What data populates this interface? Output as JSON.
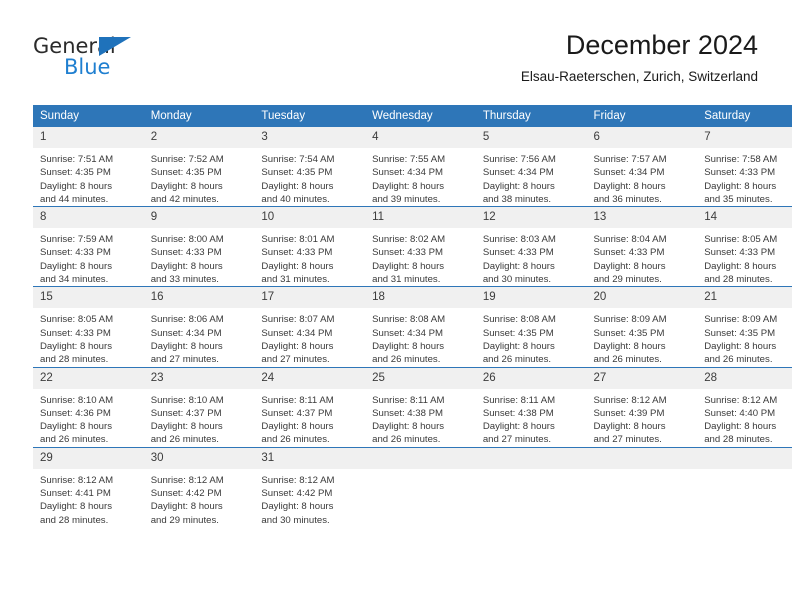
{
  "logo": {
    "word_top": "General",
    "word_bottom": "Blue",
    "triangle_icon": "triangle-icon",
    "color_dark": "#2b2b2b",
    "color_blue": "#1f7fd0"
  },
  "header": {
    "title": "December 2024",
    "subtitle": "Elsau-Raeterschen, Zurich, Switzerland"
  },
  "theme": {
    "header_blue": "#2e76b8",
    "daynum_band": "#f0f0f0",
    "text": "#3a3a3a"
  },
  "calendar": {
    "weekday_headers": [
      "Sunday",
      "Monday",
      "Tuesday",
      "Wednesday",
      "Thursday",
      "Friday",
      "Saturday"
    ],
    "weeks": [
      [
        {
          "day": "1",
          "sunrise": "Sunrise: 7:51 AM",
          "sunset": "Sunset: 4:35 PM",
          "daylight_1": "Daylight: 8 hours",
          "daylight_2": "and 44 minutes."
        },
        {
          "day": "2",
          "sunrise": "Sunrise: 7:52 AM",
          "sunset": "Sunset: 4:35 PM",
          "daylight_1": "Daylight: 8 hours",
          "daylight_2": "and 42 minutes."
        },
        {
          "day": "3",
          "sunrise": "Sunrise: 7:54 AM",
          "sunset": "Sunset: 4:35 PM",
          "daylight_1": "Daylight: 8 hours",
          "daylight_2": "and 40 minutes."
        },
        {
          "day": "4",
          "sunrise": "Sunrise: 7:55 AM",
          "sunset": "Sunset: 4:34 PM",
          "daylight_1": "Daylight: 8 hours",
          "daylight_2": "and 39 minutes."
        },
        {
          "day": "5",
          "sunrise": "Sunrise: 7:56 AM",
          "sunset": "Sunset: 4:34 PM",
          "daylight_1": "Daylight: 8 hours",
          "daylight_2": "and 38 minutes."
        },
        {
          "day": "6",
          "sunrise": "Sunrise: 7:57 AM",
          "sunset": "Sunset: 4:34 PM",
          "daylight_1": "Daylight: 8 hours",
          "daylight_2": "and 36 minutes."
        },
        {
          "day": "7",
          "sunrise": "Sunrise: 7:58 AM",
          "sunset": "Sunset: 4:33 PM",
          "daylight_1": "Daylight: 8 hours",
          "daylight_2": "and 35 minutes."
        }
      ],
      [
        {
          "day": "8",
          "sunrise": "Sunrise: 7:59 AM",
          "sunset": "Sunset: 4:33 PM",
          "daylight_1": "Daylight: 8 hours",
          "daylight_2": "and 34 minutes."
        },
        {
          "day": "9",
          "sunrise": "Sunrise: 8:00 AM",
          "sunset": "Sunset: 4:33 PM",
          "daylight_1": "Daylight: 8 hours",
          "daylight_2": "and 33 minutes."
        },
        {
          "day": "10",
          "sunrise": "Sunrise: 8:01 AM",
          "sunset": "Sunset: 4:33 PM",
          "daylight_1": "Daylight: 8 hours",
          "daylight_2": "and 31 minutes."
        },
        {
          "day": "11",
          "sunrise": "Sunrise: 8:02 AM",
          "sunset": "Sunset: 4:33 PM",
          "daylight_1": "Daylight: 8 hours",
          "daylight_2": "and 31 minutes."
        },
        {
          "day": "12",
          "sunrise": "Sunrise: 8:03 AM",
          "sunset": "Sunset: 4:33 PM",
          "daylight_1": "Daylight: 8 hours",
          "daylight_2": "and 30 minutes."
        },
        {
          "day": "13",
          "sunrise": "Sunrise: 8:04 AM",
          "sunset": "Sunset: 4:33 PM",
          "daylight_1": "Daylight: 8 hours",
          "daylight_2": "and 29 minutes."
        },
        {
          "day": "14",
          "sunrise": "Sunrise: 8:05 AM",
          "sunset": "Sunset: 4:33 PM",
          "daylight_1": "Daylight: 8 hours",
          "daylight_2": "and 28 minutes."
        }
      ],
      [
        {
          "day": "15",
          "sunrise": "Sunrise: 8:05 AM",
          "sunset": "Sunset: 4:33 PM",
          "daylight_1": "Daylight: 8 hours",
          "daylight_2": "and 28 minutes."
        },
        {
          "day": "16",
          "sunrise": "Sunrise: 8:06 AM",
          "sunset": "Sunset: 4:34 PM",
          "daylight_1": "Daylight: 8 hours",
          "daylight_2": "and 27 minutes."
        },
        {
          "day": "17",
          "sunrise": "Sunrise: 8:07 AM",
          "sunset": "Sunset: 4:34 PM",
          "daylight_1": "Daylight: 8 hours",
          "daylight_2": "and 27 minutes."
        },
        {
          "day": "18",
          "sunrise": "Sunrise: 8:08 AM",
          "sunset": "Sunset: 4:34 PM",
          "daylight_1": "Daylight: 8 hours",
          "daylight_2": "and 26 minutes."
        },
        {
          "day": "19",
          "sunrise": "Sunrise: 8:08 AM",
          "sunset": "Sunset: 4:35 PM",
          "daylight_1": "Daylight: 8 hours",
          "daylight_2": "and 26 minutes."
        },
        {
          "day": "20",
          "sunrise": "Sunrise: 8:09 AM",
          "sunset": "Sunset: 4:35 PM",
          "daylight_1": "Daylight: 8 hours",
          "daylight_2": "and 26 minutes."
        },
        {
          "day": "21",
          "sunrise": "Sunrise: 8:09 AM",
          "sunset": "Sunset: 4:35 PM",
          "daylight_1": "Daylight: 8 hours",
          "daylight_2": "and 26 minutes."
        }
      ],
      [
        {
          "day": "22",
          "sunrise": "Sunrise: 8:10 AM",
          "sunset": "Sunset: 4:36 PM",
          "daylight_1": "Daylight: 8 hours",
          "daylight_2": "and 26 minutes."
        },
        {
          "day": "23",
          "sunrise": "Sunrise: 8:10 AM",
          "sunset": "Sunset: 4:37 PM",
          "daylight_1": "Daylight: 8 hours",
          "daylight_2": "and 26 minutes."
        },
        {
          "day": "24",
          "sunrise": "Sunrise: 8:11 AM",
          "sunset": "Sunset: 4:37 PM",
          "daylight_1": "Daylight: 8 hours",
          "daylight_2": "and 26 minutes."
        },
        {
          "day": "25",
          "sunrise": "Sunrise: 8:11 AM",
          "sunset": "Sunset: 4:38 PM",
          "daylight_1": "Daylight: 8 hours",
          "daylight_2": "and 26 minutes."
        },
        {
          "day": "26",
          "sunrise": "Sunrise: 8:11 AM",
          "sunset": "Sunset: 4:38 PM",
          "daylight_1": "Daylight: 8 hours",
          "daylight_2": "and 27 minutes."
        },
        {
          "day": "27",
          "sunrise": "Sunrise: 8:12 AM",
          "sunset": "Sunset: 4:39 PM",
          "daylight_1": "Daylight: 8 hours",
          "daylight_2": "and 27 minutes."
        },
        {
          "day": "28",
          "sunrise": "Sunrise: 8:12 AM",
          "sunset": "Sunset: 4:40 PM",
          "daylight_1": "Daylight: 8 hours",
          "daylight_2": "and 28 minutes."
        }
      ],
      [
        {
          "day": "29",
          "sunrise": "Sunrise: 8:12 AM",
          "sunset": "Sunset: 4:41 PM",
          "daylight_1": "Daylight: 8 hours",
          "daylight_2": "and 28 minutes."
        },
        {
          "day": "30",
          "sunrise": "Sunrise: 8:12 AM",
          "sunset": "Sunset: 4:42 PM",
          "daylight_1": "Daylight: 8 hours",
          "daylight_2": "and 29 minutes."
        },
        {
          "day": "31",
          "sunrise": "Sunrise: 8:12 AM",
          "sunset": "Sunset: 4:42 PM",
          "daylight_1": "Daylight: 8 hours",
          "daylight_2": "and 30 minutes."
        },
        {
          "day": "",
          "sunrise": "",
          "sunset": "",
          "daylight_1": "",
          "daylight_2": ""
        },
        {
          "day": "",
          "sunrise": "",
          "sunset": "",
          "daylight_1": "",
          "daylight_2": ""
        },
        {
          "day": "",
          "sunrise": "",
          "sunset": "",
          "daylight_1": "",
          "daylight_2": ""
        },
        {
          "day": "",
          "sunrise": "",
          "sunset": "",
          "daylight_1": "",
          "daylight_2": ""
        }
      ]
    ]
  }
}
